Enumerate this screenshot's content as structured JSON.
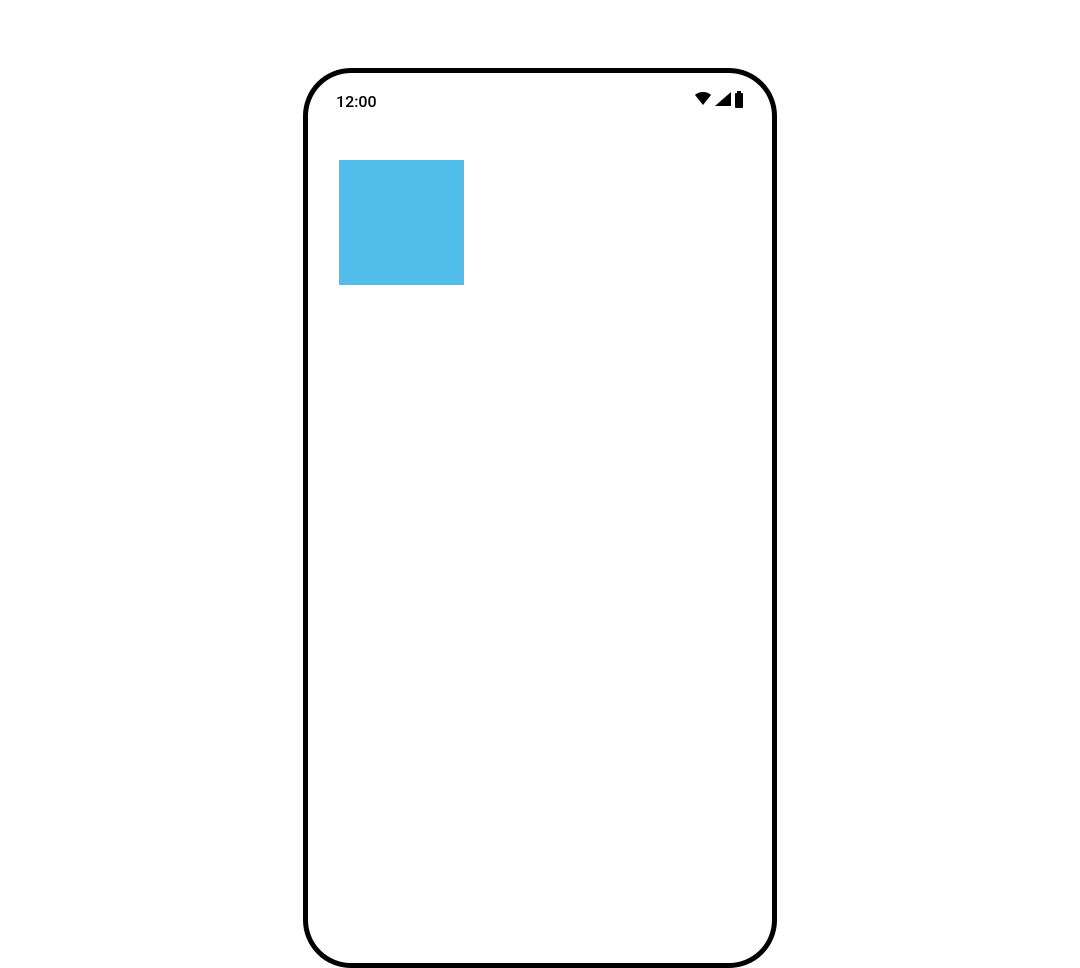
{
  "status_bar": {
    "time": "12:00"
  },
  "colors": {
    "square": "#51bdeb",
    "frame_border": "#000000",
    "touch_highlight": "rgba(255,255,255,0.5)"
  }
}
